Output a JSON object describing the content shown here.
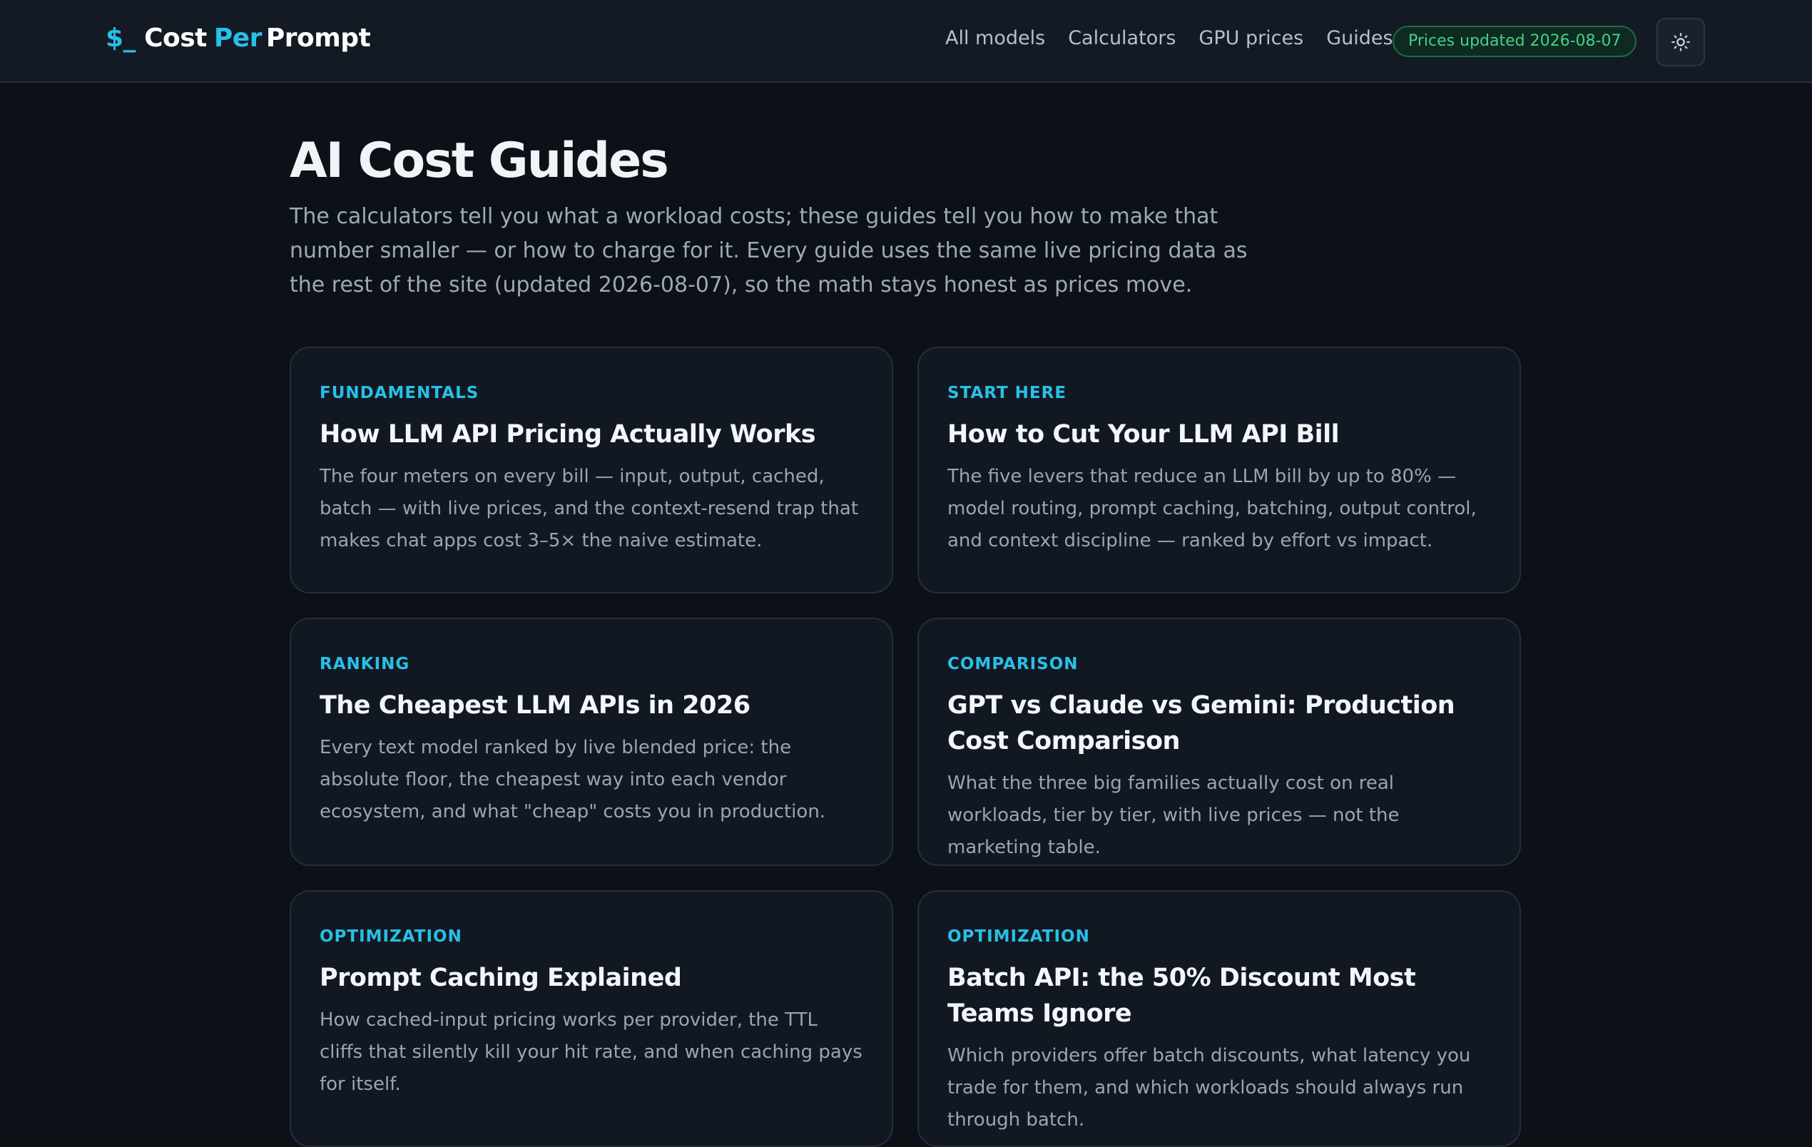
{
  "header": {
    "brand": {
      "symbol": "$_",
      "word1": "Cost",
      "word2": "Per",
      "word3": "Prompt"
    },
    "nav": [
      "All models",
      "Calculators",
      "GPU prices",
      "Guides"
    ],
    "status_badge": "Prices updated 2026-08-07",
    "theme_toggle_icon": "sun-icon"
  },
  "page": {
    "title": "AI Cost Guides",
    "intro": "The calculators tell you what a workload costs; these guides tell you how to make that number smaller — or how to charge for it. Every guide uses the same live pricing data as the rest of the site (updated 2026-08-07), so the math stays honest as prices move."
  },
  "guides": [
    {
      "category": "FUNDAMENTALS",
      "title": "How LLM API Pricing Actually Works",
      "summary": "The four meters on every bill — input, output, cached, batch — with live prices, and the context-resend trap that makes chat apps cost 3–5× the naive estimate."
    },
    {
      "category": "START HERE",
      "title": "How to Cut Your LLM API Bill",
      "summary": "The five levers that reduce an LLM bill by up to 80% — model routing, prompt caching, batching, output control, and context discipline — ranked by effort vs impact."
    },
    {
      "category": "RANKING",
      "title": "The Cheapest LLM APIs in 2026",
      "summary": "Every text model ranked by live blended price: the absolute floor, the cheapest way into each vendor ecosystem, and what \"cheap\" costs you in production."
    },
    {
      "category": "COMPARISON",
      "title": "GPT vs Claude vs Gemini: Production Cost Comparison",
      "summary": "What the three big families actually cost on real workloads, tier by tier, with live prices — not the marketing table."
    },
    {
      "category": "OPTIMIZATION",
      "title": "Prompt Caching Explained",
      "summary": "How cached-input pricing works per provider, the TTL cliffs that silently kill your hit rate, and when caching pays for itself."
    },
    {
      "category": "OPTIMIZATION",
      "title": "Batch API: the 50% Discount Most Teams Ignore",
      "summary": "Which providers offer batch discounts, what latency you trade for them, and which workloads should always run through batch."
    }
  ],
  "colors": {
    "accent": "#27c0e8",
    "badge_green": "#3fd488",
    "background": "#0c1017",
    "card": "#121821"
  }
}
